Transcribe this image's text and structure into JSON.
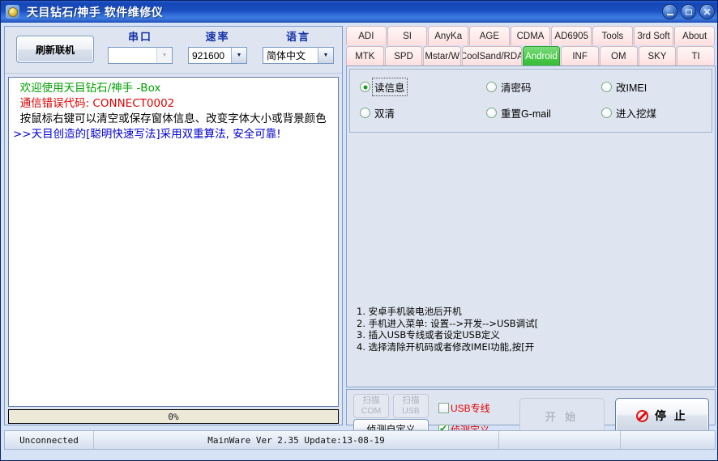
{
  "window": {
    "title": "天目钻石/神手  软件维修仪",
    "icon": "app-globe-icon",
    "buttons": {
      "minimize": "minimize-icon",
      "maximize": "maximize-icon",
      "close": "close-icon"
    }
  },
  "toolbar": {
    "refresh_label": "刷新联机",
    "fields": [
      {
        "label": "串口",
        "value": "",
        "disabled": true
      },
      {
        "label": "速率",
        "value": "921600",
        "disabled": false
      },
      {
        "label": "语言",
        "value": "简体中文",
        "disabled": false
      }
    ]
  },
  "log": {
    "lines": [
      {
        "text": "  欢迎使用天目钻石/神手 -Box",
        "color": "#00a000"
      },
      {
        "text": "  通信错误代码: CONNECT0002",
        "color": "#e00000"
      },
      {
        "text": "  按鼠标右键可以清空或保存窗体信息、改变字体大小或背景颜色",
        "color": "#000000"
      },
      {
        "text": ">>天目创造的[聪明快速写法]采用双重算法, 安全可靠!",
        "color": "#0000d0"
      }
    ]
  },
  "progress": {
    "percent_label": "0%",
    "value": 0
  },
  "tabs": {
    "row1": [
      "ADI",
      "SI",
      "AnyKa",
      "AGE",
      "CDMA",
      "AD6905",
      "Tools",
      "3rd Soft",
      "About"
    ],
    "row2": [
      "MTK",
      "SPD",
      "Mstar/W",
      "CoolSand/RDA",
      "Android",
      "INF",
      "OM",
      "SKY",
      "TI"
    ],
    "active": "Android"
  },
  "options": [
    {
      "label": "读信息",
      "selected": true,
      "focused": true
    },
    {
      "label": "清密码",
      "selected": false,
      "focused": false
    },
    {
      "label": "改IMEI",
      "selected": false,
      "focused": false
    },
    {
      "label": "双清",
      "selected": false,
      "focused": false
    },
    {
      "label": "重置G-mail",
      "selected": false,
      "focused": false
    },
    {
      "label": "进入挖煤",
      "selected": false,
      "focused": false
    }
  ],
  "howto": {
    "lines": [
      "1. 安卓手机装电池后开机",
      "2. 手机进入菜单: 设置-->开发-->USB调试[",
      "3. 插入USB专线或者设定USB定义",
      "4. 选择清除开机码或者修改IMEI功能,按[开"
    ]
  },
  "actions": {
    "scan_com_line1": "扫描",
    "scan_com_line2": "COM",
    "scan_usb_line1": "扫描",
    "scan_usb_line2": "USB",
    "detect_custom_label": "侦测自定义",
    "checkbox_usb_line": {
      "label": "USB专线",
      "checked": false
    },
    "checkbox_detect_def": {
      "label": "侦测定义",
      "checked": true
    },
    "start_label": "开 始",
    "stop_label": "停 止",
    "stop_icon": "prohibition-icon"
  },
  "statusbar": {
    "connection": "Unconnected",
    "version": "MainWare Ver 2.35  Update:13-08-19",
    "cell3": "",
    "cell4": ""
  }
}
